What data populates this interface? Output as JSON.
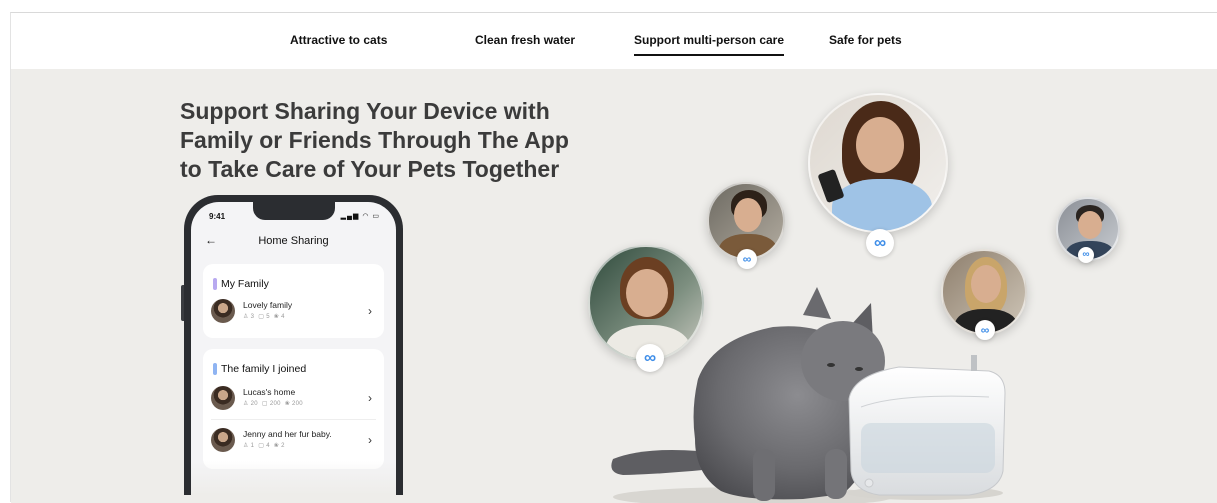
{
  "tabs": [
    {
      "label": "Attractive to cats",
      "active": false
    },
    {
      "label": "Clean fresh water",
      "active": false
    },
    {
      "label": "Support multi-person care",
      "active": true
    },
    {
      "label": "Safe for pets",
      "active": false
    }
  ],
  "headline": [
    "Support Sharing Your Device with",
    "Family or Friends Through The App",
    "to Take Care of Your Pets Together"
  ],
  "phone": {
    "status_time": "9:41",
    "status_icons": "signal-icon wifi-icon battery-icon",
    "nav_back_icon": "arrow-left-icon",
    "nav_title": "Home Sharing",
    "groups": [
      {
        "title": "My Family",
        "items": [
          {
            "name": "Lovely family",
            "members": "3",
            "devices": "5",
            "pets": "4"
          }
        ]
      },
      {
        "title": "The family I joined",
        "items": [
          {
            "name": "Lucas's home",
            "members": "20",
            "devices": "200",
            "pets": "200"
          },
          {
            "name": "Jenny and her fur baby.",
            "members": "1",
            "devices": "4",
            "pets": "2"
          }
        ]
      }
    ]
  },
  "collage": {
    "badge_icon": "infinity-icon",
    "badge_glyph": "∞",
    "badge_color": "#3f8ee8"
  }
}
